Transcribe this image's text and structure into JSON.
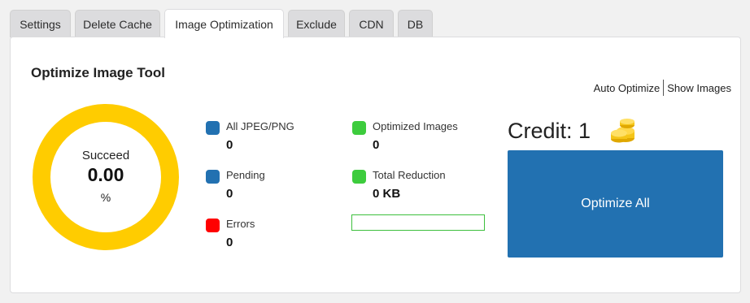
{
  "tabs": [
    {
      "label": "Settings"
    },
    {
      "label": "Delete Cache"
    },
    {
      "label": "Image Optimization"
    },
    {
      "label": "Exclude"
    },
    {
      "label": "CDN"
    },
    {
      "label": "DB"
    }
  ],
  "active_tab": "Image Optimization",
  "panel": {
    "title": "Optimize Image Tool",
    "links": {
      "auto_optimize": "Auto Optimize",
      "show_images": "Show Images"
    }
  },
  "donut": {
    "label": "Succeed",
    "value": "0.00",
    "unit": "%",
    "color": "#ffcc00"
  },
  "stats": {
    "all": {
      "name": "All JPEG/PNG",
      "value": "0",
      "color": "#2271b1"
    },
    "pending": {
      "name": "Pending",
      "value": "0",
      "color": "#2271b1"
    },
    "errors": {
      "name": "Errors",
      "value": "0",
      "color": "#ff0000"
    },
    "optimized": {
      "name": "Optimized Images",
      "value": "0",
      "color": "#3dcc3d"
    },
    "reduction": {
      "name": "Total Reduction",
      "value": "0 KB",
      "color": "#3dcc3d"
    }
  },
  "reduction_progress": 0,
  "credit": {
    "text": "Credit: 1",
    "icon": "coins-icon"
  },
  "optimize_button": {
    "label": "Optimize All",
    "color": "#2271b1"
  }
}
